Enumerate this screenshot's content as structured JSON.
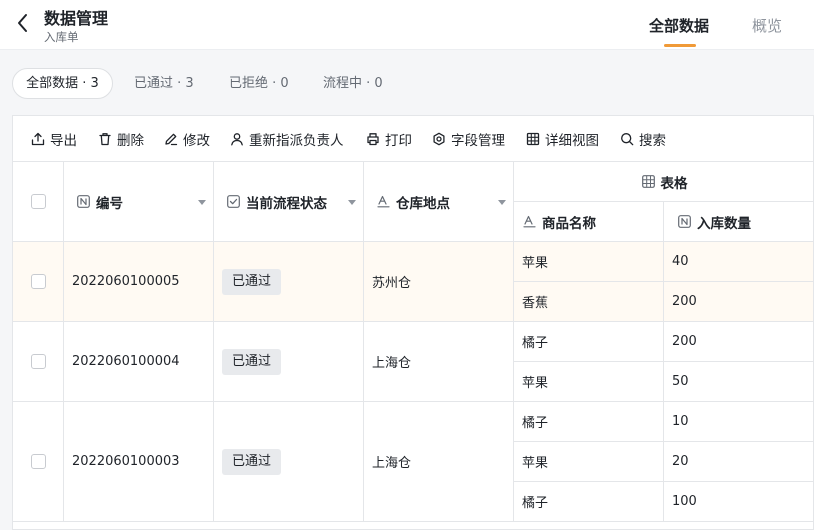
{
  "header": {
    "title": "数据管理",
    "subtitle": "入库单",
    "tabs": [
      {
        "label": "全部数据",
        "active": true
      },
      {
        "label": "概览",
        "active": false
      }
    ],
    "accent_color": "#f09a37"
  },
  "filters": [
    {
      "label": "全部数据 · 3",
      "active": true
    },
    {
      "label": "已通过 · 3",
      "active": false
    },
    {
      "label": "已拒绝 · 0",
      "active": false
    },
    {
      "label": "流程中 · 0",
      "active": false
    }
  ],
  "toolbar": {
    "export": {
      "label": "导出",
      "icon": "export-icon"
    },
    "delete": {
      "label": "删除",
      "icon": "trash-icon"
    },
    "edit": {
      "label": "修改",
      "icon": "edit-icon"
    },
    "reassign": {
      "label": "重新指派负责人",
      "icon": "user-icon"
    },
    "print": {
      "label": "打印",
      "icon": "printer-icon"
    },
    "fields": {
      "label": "字段管理",
      "icon": "settings-icon"
    },
    "detail": {
      "label": "详细视图",
      "icon": "grid-icon"
    },
    "search": {
      "label": "搜索",
      "icon": "search-icon"
    }
  },
  "table": {
    "columns": {
      "id": "编号",
      "status": "当前流程状态",
      "warehouse": "仓库地点",
      "group": "表格",
      "product": "商品名称",
      "quantity": "入库数量"
    },
    "rows": [
      {
        "id": "2022060100005",
        "status": "已通过",
        "warehouse": "苏州仓",
        "items": [
          {
            "product": "苹果",
            "quantity": "40"
          },
          {
            "product": "香蕉",
            "quantity": "200"
          }
        ]
      },
      {
        "id": "2022060100004",
        "status": "已通过",
        "warehouse": "上海仓",
        "items": [
          {
            "product": "橘子",
            "quantity": "200"
          },
          {
            "product": "苹果",
            "quantity": "50"
          }
        ]
      },
      {
        "id": "2022060100003",
        "status": "已通过",
        "warehouse": "上海仓",
        "items": [
          {
            "product": "橘子",
            "quantity": "10"
          },
          {
            "product": "苹果",
            "quantity": "20"
          },
          {
            "product": "橘子",
            "quantity": "100"
          }
        ]
      }
    ]
  }
}
